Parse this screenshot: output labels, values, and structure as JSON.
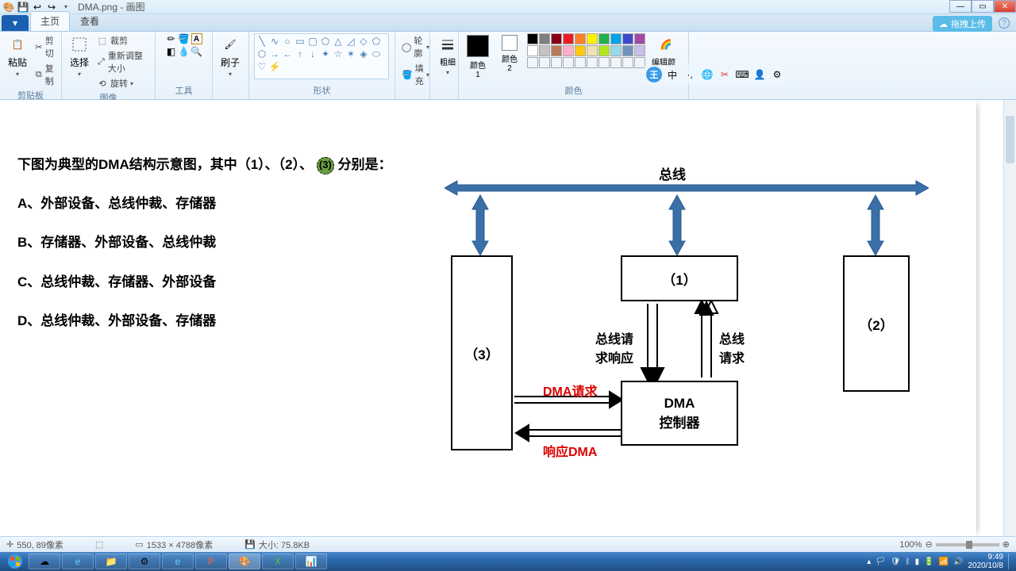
{
  "titlebar": {
    "filename": "DMA.png - 画图"
  },
  "window": {
    "min": "—",
    "max": "▭",
    "close": "✕"
  },
  "tabs": {
    "file": "▾",
    "home": "主页",
    "view": "查看"
  },
  "cloud": {
    "upload": "拖拽上传"
  },
  "ribbon": {
    "clipboard": {
      "label": "剪贴板",
      "paste": "粘贴",
      "cut": "剪切",
      "copy": "复制"
    },
    "image": {
      "label": "图像",
      "select": "选择",
      "crop": "裁剪",
      "resize": "重新调整大小",
      "rotate": "旋转"
    },
    "tools": {
      "label": "工具",
      "brush": "刷子"
    },
    "shapes": {
      "label": "形状",
      "outline": "轮廓",
      "fill": "填充"
    },
    "thickness": {
      "label": "粗细"
    },
    "colors": {
      "label": "颜色",
      "c1": "颜色 1",
      "c2": "颜色 2",
      "edit": "编辑颜色"
    }
  },
  "content": {
    "question": "下图为典型的DMA结构示意图，其中（1）、（2）、",
    "question_suffix": " 分别是：",
    "circle": "(3)",
    "optA": "A、外部设备、总线仲裁、存储器",
    "optB": "B、存储器、外部设备、总线仲裁",
    "optC": "C、总线仲裁、存储器、外部设备",
    "optD": "D、总线仲裁、外部设备、存储器",
    "bus": "总线",
    "box1": "（1）",
    "box2": "（2）",
    "box3": "（3）",
    "dma_ctrl1": "DMA",
    "dma_ctrl2": "控制器",
    "req_resp1": "总线请",
    "req_resp2": "求响应",
    "bus_req1": "总线",
    "bus_req2": "请求",
    "dma_req": "DMA请求",
    "dma_resp": "响应DMA"
  },
  "status": {
    "pos": "550, 89像素",
    "dim": "1533 × 4788像素",
    "size": "大小: 75.8KB",
    "zoom": "100%"
  },
  "tray": {
    "time": "9:49",
    "date": "2020/10/8"
  },
  "chart_data": {
    "type": "diagram",
    "title": "典型的DMA结构示意图",
    "nodes": [
      {
        "id": "bus",
        "label": "总线"
      },
      {
        "id": "n1",
        "label": "（1）"
      },
      {
        "id": "n2",
        "label": "（2）"
      },
      {
        "id": "n3",
        "label": "（3）"
      },
      {
        "id": "dmac",
        "label": "DMA控制器"
      }
    ],
    "edges": [
      {
        "from": "n3",
        "to": "bus",
        "dir": "both"
      },
      {
        "from": "n1",
        "to": "bus",
        "dir": "both"
      },
      {
        "from": "n2",
        "to": "bus",
        "dir": "both"
      },
      {
        "from": "n1",
        "to": "dmac",
        "label": "总线请求响应",
        "dir": "down"
      },
      {
        "from": "dmac",
        "to": "n1",
        "label": "总线请求",
        "dir": "up"
      },
      {
        "from": "n3",
        "to": "dmac",
        "label": "DMA请求",
        "dir": "right"
      },
      {
        "from": "dmac",
        "to": "n3",
        "label": "响应DMA",
        "dir": "left"
      }
    ],
    "question_options": {
      "A": "外部设备、总线仲裁、存储器",
      "B": "存储器、外部设备、总线仲裁",
      "C": "总线仲裁、存储器、外部设备",
      "D": "总线仲裁、外部设备、存储器"
    }
  }
}
